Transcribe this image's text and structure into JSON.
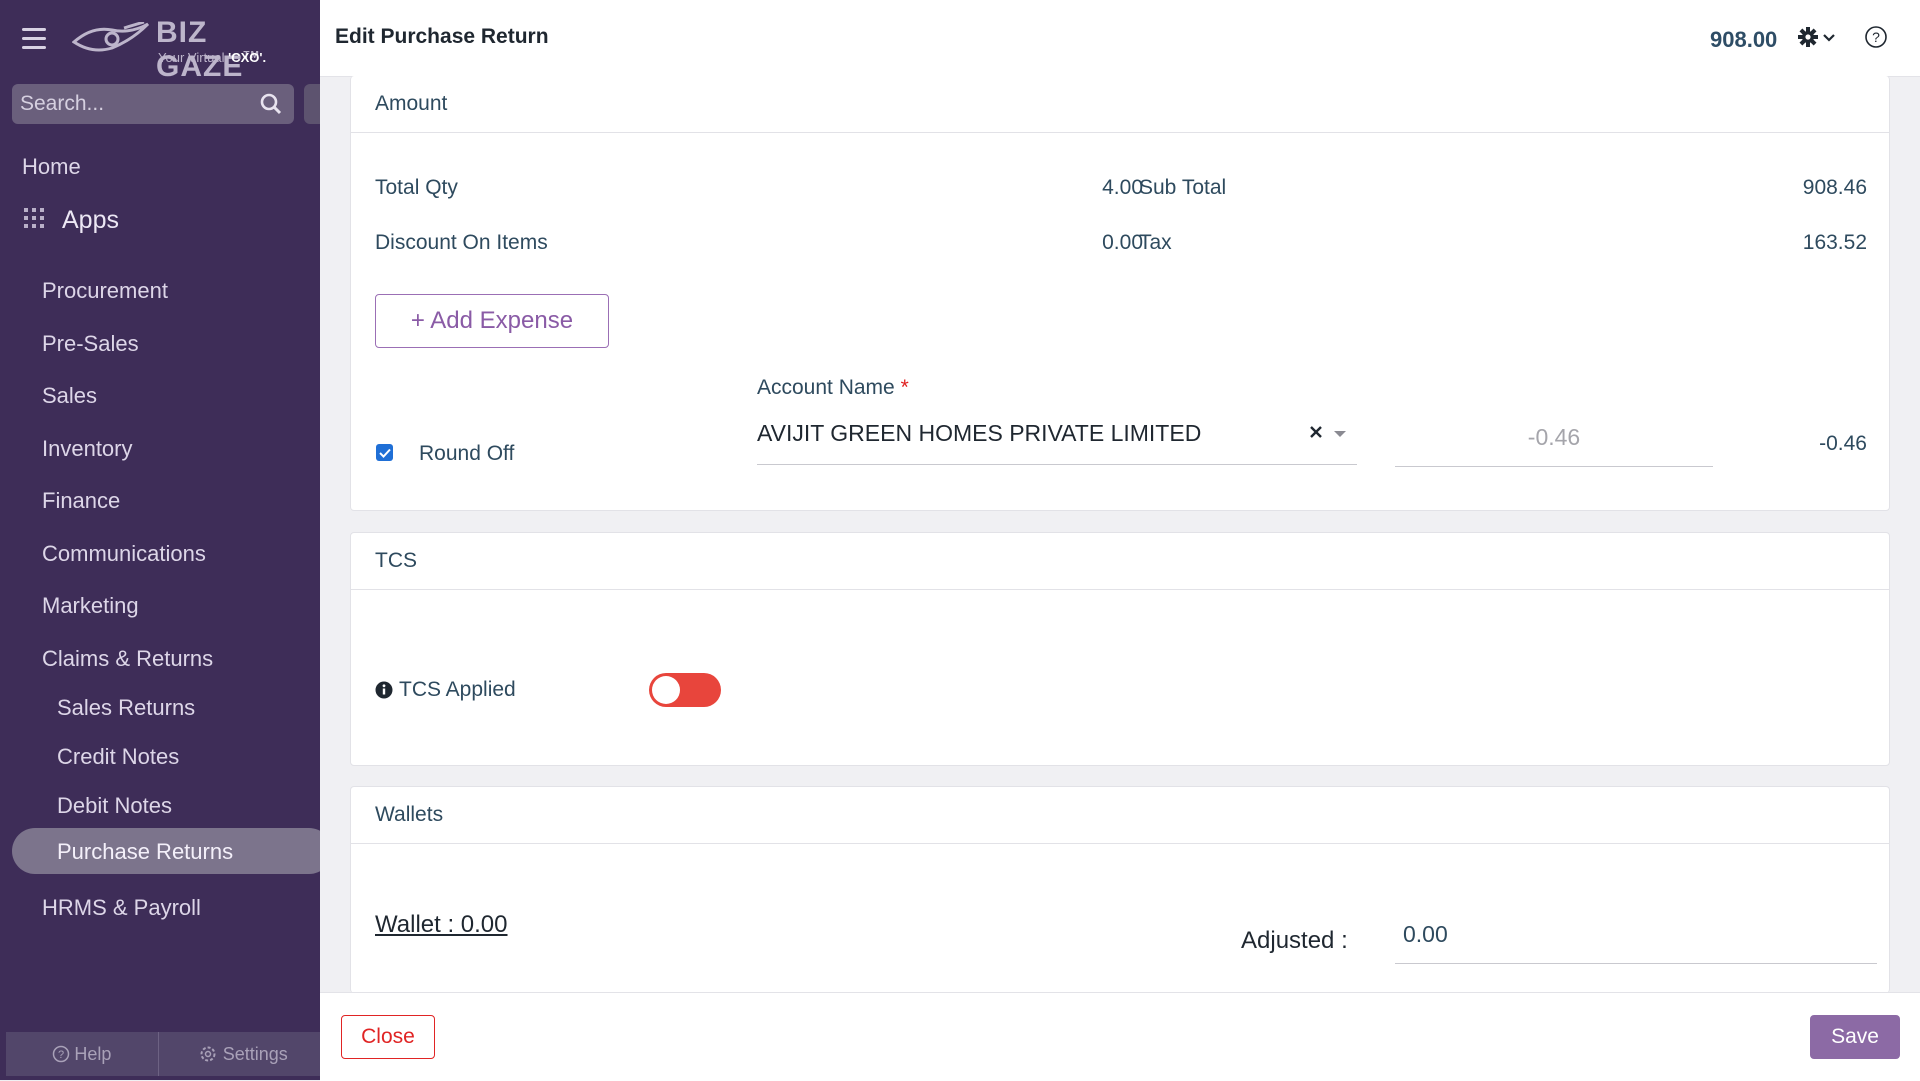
{
  "sidebar": {
    "logo": {
      "word": "BIZ GAZE",
      "tm": "TM",
      "tagline_prefix": "Your Virtual ",
      "tagline_bold": "'CXO'."
    },
    "search_placeholder": "Search...",
    "home": "Home",
    "apps": "Apps",
    "items": [
      "Procurement",
      "Pre-Sales",
      "Sales",
      "Inventory",
      "Finance",
      "Communications",
      "Marketing",
      "Claims & Returns"
    ],
    "sub_items": [
      "Sales Returns",
      "Credit Notes",
      "Debit Notes",
      "Purchase Returns"
    ],
    "active_item": "Purchase Returns",
    "after_items": [
      "HRMS & Payroll"
    ],
    "help": "Help",
    "settings": "Settings"
  },
  "header": {
    "title": "Edit Purchase Return",
    "total": "908.00"
  },
  "amount": {
    "heading": "Amount",
    "total_qty_label": "Total Qty",
    "total_qty": "4.00",
    "discount_label": "Discount On Items",
    "discount": "0.00",
    "sub_total_label": "Sub Total",
    "sub_total": "908.46",
    "tax_label": "Tax",
    "tax": "163.52",
    "add_expense": "+ Add Expense",
    "round_off_label": "Round Off",
    "round_off_checked": true,
    "account_name_label": "Account Name",
    "required_mark": "*",
    "account_name_value": "AVIJIT GREEN HOMES PRIVATE LIMITED",
    "round_off_input_placeholder": "-0.46",
    "round_off_value": "-0.46"
  },
  "tcs": {
    "heading": "TCS",
    "applied_label": "TCS Applied",
    "applied": false,
    "toggle_color": "#e8453c"
  },
  "wallets": {
    "heading": "Wallets",
    "wallet_text": "Wallet : 0.00",
    "adjusted_label": "Adjusted :",
    "adjusted_value": "0.00"
  },
  "footer": {
    "close": "Close",
    "save": "Save"
  },
  "colors": {
    "sidebar_bg": "#3e2d58",
    "accent": "#8c6aa5",
    "danger": "#e02424"
  }
}
